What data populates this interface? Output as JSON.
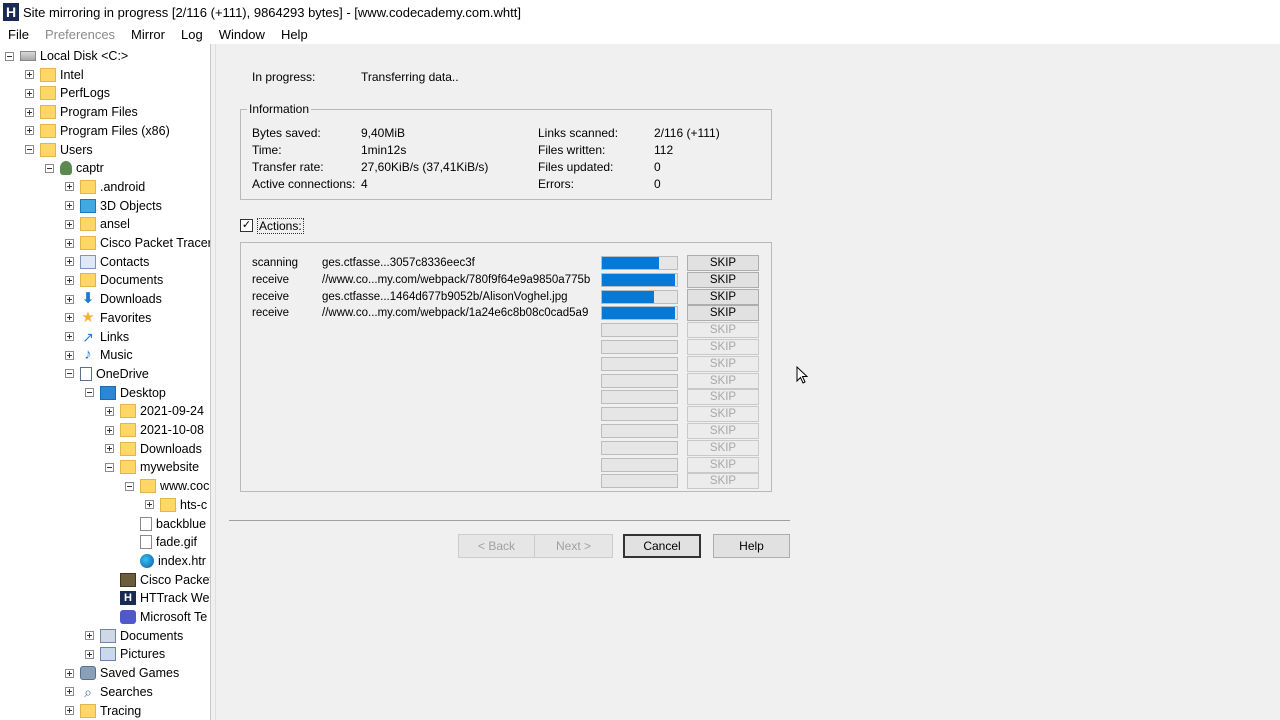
{
  "window": {
    "app_icon": "httrack-app-icon",
    "title": "Site mirroring in progress [2/116 (+111), 9864293 bytes] - [www.codecademy.com.whtt]"
  },
  "menu": [
    "File",
    "Preferences",
    "Mirror",
    "Log",
    "Window",
    "Help"
  ],
  "tree": [
    {
      "label": "Local Disk <C:>",
      "icon": "drive-icon",
      "expander": "minus"
    },
    {
      "label": "Intel",
      "icon": "folder-icon",
      "expander": "plus"
    },
    {
      "label": "PerfLogs",
      "icon": "folder-icon",
      "expander": "plus"
    },
    {
      "label": "Program Files",
      "icon": "folder-icon",
      "expander": "plus"
    },
    {
      "label": "Program Files (x86)",
      "icon": "folder-icon",
      "expander": "plus"
    },
    {
      "label": "Users",
      "icon": "folder-icon",
      "expander": "minus"
    },
    {
      "label": "captr",
      "icon": "user-folder-icon",
      "expander": "minus"
    },
    {
      "label": ".android",
      "icon": "folder-icon",
      "expander": "plus"
    },
    {
      "label": "3D Objects",
      "icon": "3d-objects-icon",
      "expander": "plus"
    },
    {
      "label": "ansel",
      "icon": "folder-icon",
      "expander": "plus"
    },
    {
      "label": "Cisco Packet Tracer",
      "icon": "folder-icon",
      "expander": "plus"
    },
    {
      "label": "Contacts",
      "icon": "contacts-icon",
      "expander": "plus"
    },
    {
      "label": "Documents",
      "icon": "folder-icon",
      "expander": "plus"
    },
    {
      "label": "Downloads",
      "icon": "downloads-icon",
      "expander": "plus"
    },
    {
      "label": "Favorites",
      "icon": "favorites-star-icon",
      "expander": "plus"
    },
    {
      "label": "Links",
      "icon": "links-icon",
      "expander": "plus"
    },
    {
      "label": "Music",
      "icon": "music-icon",
      "expander": "plus"
    },
    {
      "label": "OneDrive",
      "icon": "onedrive-page-icon",
      "expander": "minus"
    },
    {
      "label": "Desktop",
      "icon": "desktop-blue-folder-icon",
      "expander": "minus"
    },
    {
      "label": "2021-09-24",
      "icon": "folder-icon",
      "expander": "plus"
    },
    {
      "label": "2021-10-08",
      "icon": "folder-icon",
      "expander": "plus"
    },
    {
      "label": "Downloads",
      "icon": "folder-icon",
      "expander": "plus"
    },
    {
      "label": "mywebsite",
      "icon": "folder-icon",
      "expander": "minus"
    },
    {
      "label": "www.coc",
      "icon": "folder-icon",
      "expander": "minus"
    },
    {
      "label": "hts-c",
      "icon": "folder-icon",
      "expander": "plus"
    },
    {
      "label": "backblue",
      "icon": "document-icon",
      "expander": "none"
    },
    {
      "label": "fade.gif",
      "icon": "document-icon",
      "expander": "none"
    },
    {
      "label": "index.htr",
      "icon": "edge-browser-icon",
      "expander": "none"
    },
    {
      "label": "Cisco Packet",
      "icon": "cisco-shortcut-icon",
      "expander": "none"
    },
    {
      "label": "HTTrack Wel",
      "icon": "httrack-icon",
      "expander": "none"
    },
    {
      "label": "Microsoft Te",
      "icon": "teams-icon",
      "expander": "none"
    },
    {
      "label": "Documents",
      "icon": "documents-library-icon",
      "expander": "plus"
    },
    {
      "label": "Pictures",
      "icon": "pictures-library-icon",
      "expander": "plus"
    },
    {
      "label": "Saved Games",
      "icon": "saved-games-icon",
      "expander": "plus"
    },
    {
      "label": "Searches",
      "icon": "search-icon",
      "expander": "plus"
    },
    {
      "label": "Tracing",
      "icon": "folder-icon",
      "expander": "plus"
    }
  ],
  "status": {
    "label": "In progress:",
    "value": "Transferring data.."
  },
  "information": {
    "title": "Information",
    "left": [
      {
        "label": "Bytes saved:",
        "value": "9,40MiB"
      },
      {
        "label": "Time:",
        "value": "1min12s"
      },
      {
        "label": "Transfer rate:",
        "value": "27,60KiB/s (37,41KiB/s)"
      },
      {
        "label": "Active connections:",
        "value": "4"
      }
    ],
    "right": [
      {
        "label": "Links scanned:",
        "value": "2/116 (+111)"
      },
      {
        "label": "Files written:",
        "value": "112"
      },
      {
        "label": "Files updated:",
        "value": "0"
      },
      {
        "label": "Errors:",
        "value": "0"
      }
    ]
  },
  "actions": {
    "checkbox_checked": true,
    "checkmark": "✓",
    "label": "Actions:",
    "skip_label": "SKIP",
    "rows": [
      {
        "action": "scanning",
        "url": "ges.ctfasse...3057c8336eec3f",
        "progress": 0.76,
        "enabled": true
      },
      {
        "action": "receive",
        "url": "//www.co...my.com/webpack/780f9f64e9a9850a775b",
        "progress": 0.97,
        "enabled": true
      },
      {
        "action": "receive",
        "url": "ges.ctfasse...1464d677b9052b/AlisonVoghel.jpg",
        "progress": 0.69,
        "enabled": true
      },
      {
        "action": "receive",
        "url": "//www.co...my.com/webpack/1a24e6c8b08c0cad5a9",
        "progress": 0.97,
        "enabled": true
      },
      {
        "action": "",
        "url": "",
        "progress": 0,
        "enabled": false
      },
      {
        "action": "",
        "url": "",
        "progress": 0,
        "enabled": false
      },
      {
        "action": "",
        "url": "",
        "progress": 0,
        "enabled": false
      },
      {
        "action": "",
        "url": "",
        "progress": 0,
        "enabled": false
      },
      {
        "action": "",
        "url": "",
        "progress": 0,
        "enabled": false
      },
      {
        "action": "",
        "url": "",
        "progress": 0,
        "enabled": false
      },
      {
        "action": "",
        "url": "",
        "progress": 0,
        "enabled": false
      },
      {
        "action": "",
        "url": "",
        "progress": 0,
        "enabled": false
      },
      {
        "action": "",
        "url": "",
        "progress": 0,
        "enabled": false
      },
      {
        "action": "",
        "url": "",
        "progress": 0,
        "enabled": false
      }
    ]
  },
  "buttons": {
    "back": "< Back",
    "next": "Next >",
    "cancel": "Cancel",
    "help": "Help"
  },
  "colors": {
    "progress_fill": "#0678d6",
    "dialog_bg": "#f0f0f0"
  }
}
